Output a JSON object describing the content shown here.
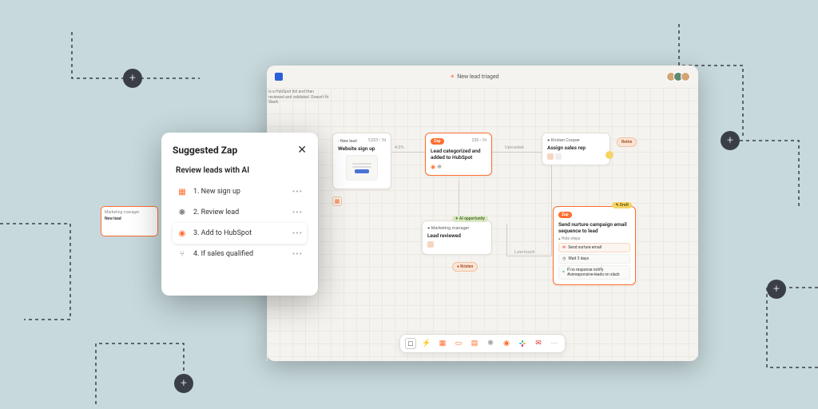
{
  "header": {
    "title": "New lead triaged"
  },
  "modal": {
    "title": "Suggested Zap",
    "subtitle": "Review leads with AI",
    "steps": [
      {
        "label": "1. New sign up",
        "icon": "form"
      },
      {
        "label": "2. Review lead",
        "icon": "ai"
      },
      {
        "label": "3. Add to HubSpot",
        "icon": "hubspot"
      },
      {
        "label": "4. If sales qualified",
        "icon": "branch"
      }
    ]
  },
  "nodes": {
    "new_lead": {
      "tag": "New lead",
      "stat": "5,523 • 7d",
      "title": "Website sign up"
    },
    "categorize": {
      "tag": "Zap",
      "stat": "220 • 7d",
      "title": "Lead categorized and added to HubSpot"
    },
    "assign": {
      "person": "Kristen Cooper",
      "title": "Assign sales rep",
      "action": "Retire"
    },
    "reviewed": {
      "person": "Marketing manager",
      "title": "Lead reviewed",
      "badge": "AI opportunity"
    },
    "nurture": {
      "tag": "Zap",
      "badge": "Draft",
      "title": "Send nurture campaign email sequence to lead",
      "hide": "Hide steps",
      "rows": [
        "Send nurture email",
        "Wait 3 days",
        "If no response notify #unresponsive-leads on slack"
      ]
    }
  },
  "chips": {
    "kristen": "Kristen"
  },
  "edges": {
    "e1": "4.0%",
    "e2": "Upmarket",
    "e3": "Low-touch"
  },
  "side_peek": {
    "l1": "Marketing manager",
    "l2": "New lead"
  },
  "descr": "is a HubSpot list and then reviewed and validated. Doesn't fit Slack.",
  "colors": {
    "accent": "#ff6d2e"
  }
}
